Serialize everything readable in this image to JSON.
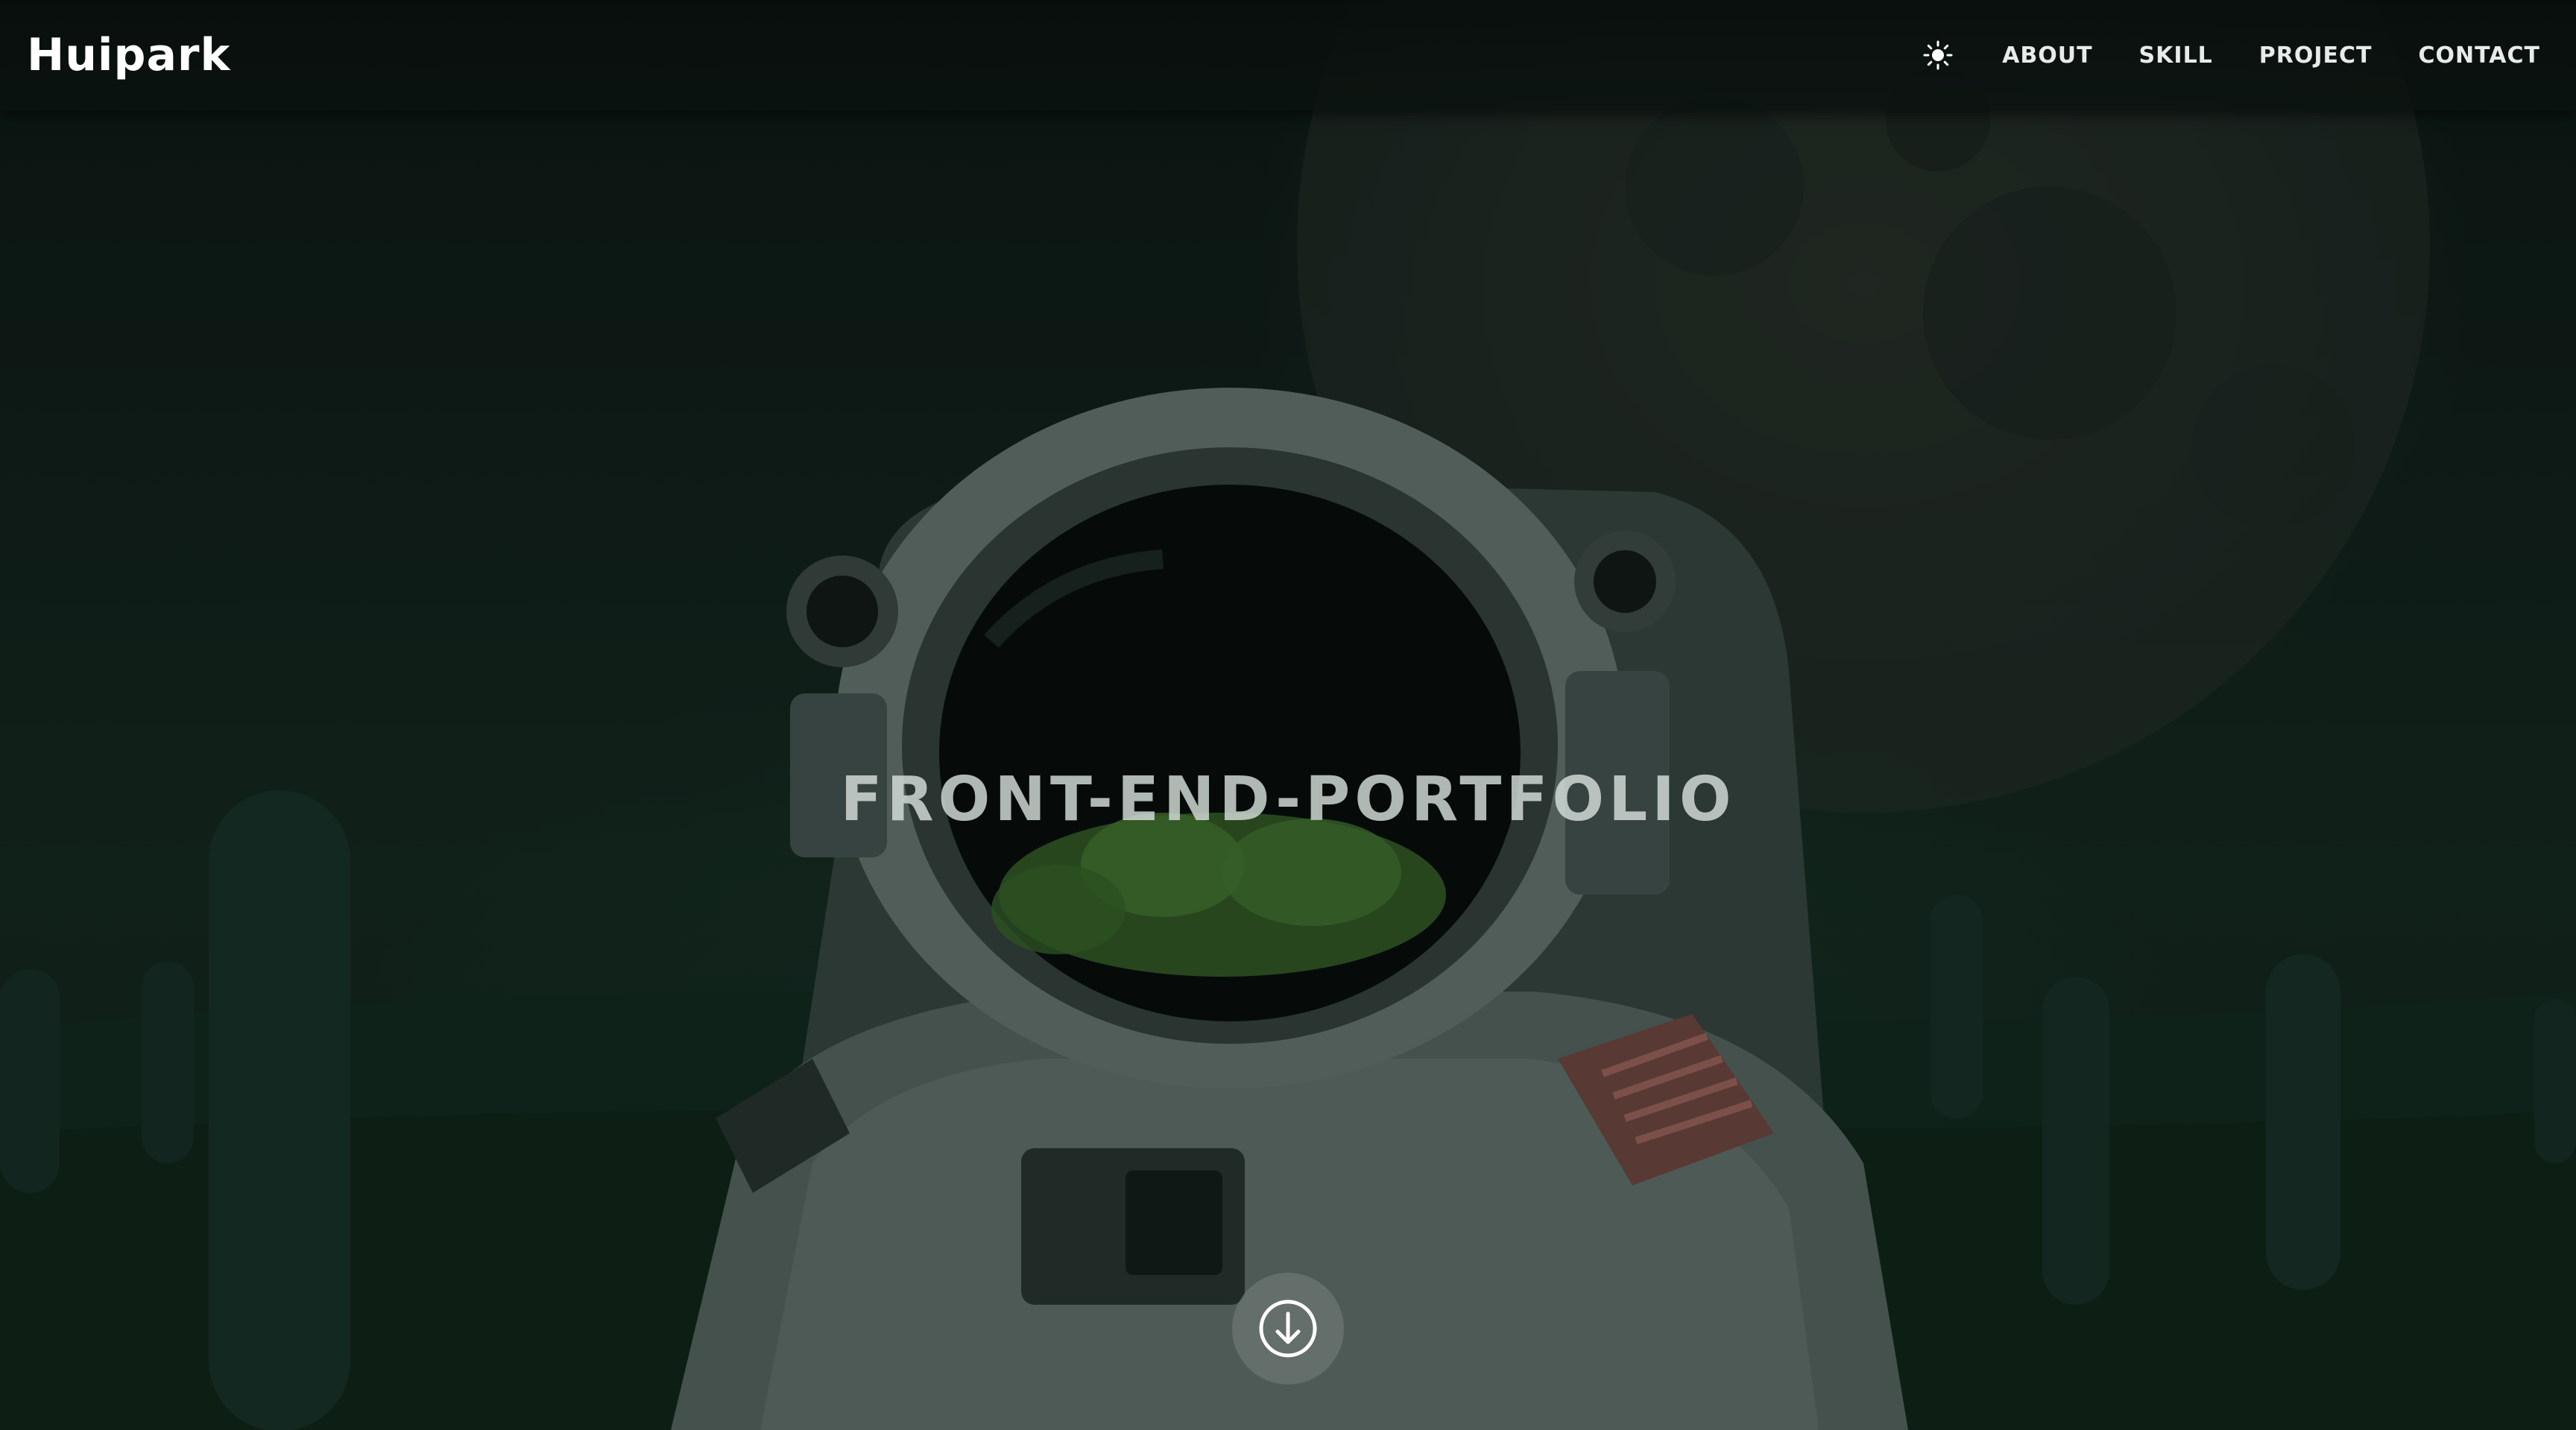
{
  "header": {
    "logo": "Huipark",
    "theme_toggle_icon": "sun-icon",
    "nav": [
      {
        "label": "ABOUT"
      },
      {
        "label": "SKILL"
      },
      {
        "label": "PROJECT"
      },
      {
        "label": "CONTACT"
      }
    ]
  },
  "hero": {
    "title": "FRONT-END-PORTFOLIO",
    "background": "astronaut-illustration",
    "scroll_icon": "arrow-down-circle-icon"
  },
  "colors": {
    "header_bg": "#0a1210",
    "nav_text": "#e7ece9",
    "hero_title": "#d6deda",
    "scroll_button": "#78807c"
  }
}
